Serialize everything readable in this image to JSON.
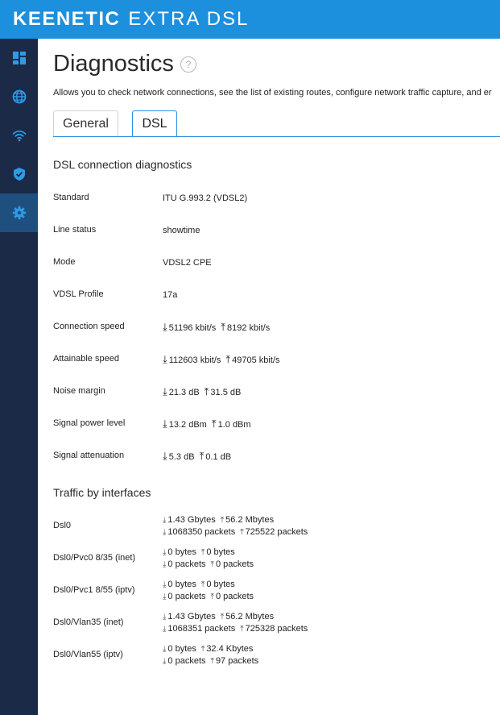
{
  "brand": {
    "name": "KEENETIC",
    "model": "EXTRA DSL"
  },
  "page": {
    "title": "Diagnostics",
    "help": "?",
    "description": "Allows you to check network connections, see the list of existing routes, configure network traffic capture, and er"
  },
  "tabs": [
    {
      "label": "General",
      "active": false
    },
    {
      "label": "DSL",
      "active": true
    }
  ],
  "dsl": {
    "section_title": "DSL connection diagnostics",
    "rows": [
      {
        "label": "Standard",
        "value": "ITU G.993.2 (VDSL2)"
      },
      {
        "label": "Line status",
        "value": "showtime"
      },
      {
        "label": "Mode",
        "value": "VDSL2 CPE"
      },
      {
        "label": "VDSL Profile",
        "value": "17a"
      },
      {
        "label": "Connection speed",
        "down": "51196 kbit/s",
        "up": "8192 kbit/s"
      },
      {
        "label": "Attainable speed",
        "down": "112603 kbit/s",
        "up": "49705 kbit/s"
      },
      {
        "label": "Noise margin",
        "down": "21.3 dB",
        "up": "31.5 dB"
      },
      {
        "label": "Signal power level",
        "down": "13.2 dBm",
        "up": "1.0 dBm"
      },
      {
        "label": "Signal attenuation",
        "down": "5.3 dB",
        "up": "0.1 dB"
      }
    ]
  },
  "traffic": {
    "section_title": "Traffic by interfaces",
    "rows": [
      {
        "label": "Dsl0",
        "rx_bytes": "1.43 Gbytes",
        "tx_bytes": "56.2 Mbytes",
        "rx_packets": "1068350 packets",
        "tx_packets": "725522 packets"
      },
      {
        "label": "Dsl0/Pvc0 8/35 (inet)",
        "rx_bytes": "0 bytes",
        "tx_bytes": "0 bytes",
        "rx_packets": "0 packets",
        "tx_packets": "0 packets"
      },
      {
        "label": "Dsl0/Pvc1 8/55 (iptv)",
        "rx_bytes": "0 bytes",
        "tx_bytes": "0 bytes",
        "rx_packets": "0 packets",
        "tx_packets": "0 packets"
      },
      {
        "label": "Dsl0/Vlan35 (inet)",
        "rx_bytes": "1.43 Gbytes",
        "tx_bytes": "56.2 Mbytes",
        "rx_packets": "1068351 packets",
        "tx_packets": "725328 packets"
      },
      {
        "label": "Dsl0/Vlan55 (iptv)",
        "rx_bytes": "0 bytes",
        "tx_bytes": "32.4 Kbytes",
        "rx_packets": "0 packets",
        "tx_packets": "97 packets"
      }
    ]
  },
  "sidebar": {
    "items": [
      {
        "icon": "dashboard-icon",
        "active": false
      },
      {
        "icon": "globe-icon",
        "active": false
      },
      {
        "icon": "wifi-icon",
        "active": false
      },
      {
        "icon": "shield-icon",
        "active": false
      },
      {
        "icon": "gear-icon",
        "active": true
      }
    ]
  },
  "colors": {
    "topbar": "#1c8fdd",
    "sidebar": "#1a2a47",
    "sidebar_active": "#1f4f7f",
    "accent": "#2b8fdf"
  }
}
